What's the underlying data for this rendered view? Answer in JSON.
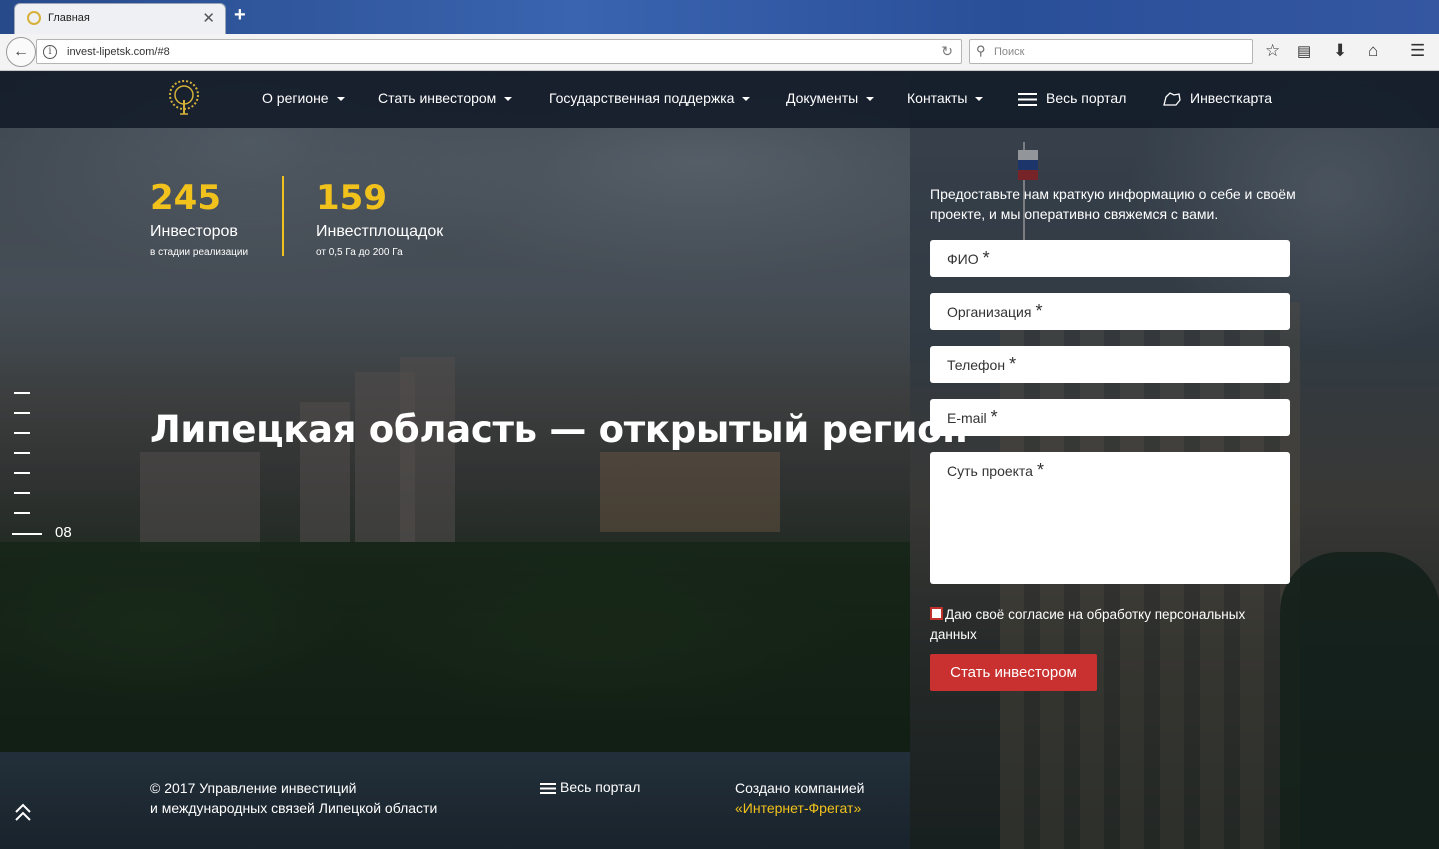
{
  "browser": {
    "tab_title": "Главная",
    "url": "invest-lipetsk.com/#8",
    "search_placeholder": "Поиск"
  },
  "nav": {
    "items": [
      {
        "label": "О регионе",
        "dropdown": true
      },
      {
        "label": "Стать инвестором",
        "dropdown": true
      },
      {
        "label": "Государственная поддержка",
        "dropdown": true
      },
      {
        "label": "Документы",
        "dropdown": true
      },
      {
        "label": "Контакты",
        "dropdown": true
      }
    ],
    "portal_label": "Весь портал",
    "investmap_label": "Инвесткарта"
  },
  "stats": [
    {
      "value": "245",
      "label": "Инвесторов",
      "sub": "в стадии реализации"
    },
    {
      "value": "159",
      "label": "Инвестплощадок",
      "sub": "от 0,5 Га до 200 Га"
    }
  ],
  "headline": "Липецкая область — открытый регион",
  "slider": {
    "current": "08"
  },
  "form": {
    "intro": "Предоставьте нам краткую информацию о себе и своём проекте, и мы оперативно свяжемся с вами.",
    "fields": {
      "name": "ФИО",
      "org": "Организация",
      "phone": "Телефон",
      "email": "E-mail",
      "project": "Суть проекта"
    },
    "required_mark": "*",
    "consent": "Даю своё согласие на обработку персональных данных",
    "submit": "Стать инвестором"
  },
  "footer": {
    "copyright_line1": "© 2017 Управление инвестиций",
    "copyright_line2": "и международных связей Липецкой области",
    "portal_label": "Весь портал",
    "created_by": "Создано компанией",
    "company": "«Интернет-Фрегат»"
  },
  "colors": {
    "accent_yellow": "#f2c21c",
    "button_red": "#c8312f",
    "header_bg": "#121a28"
  }
}
